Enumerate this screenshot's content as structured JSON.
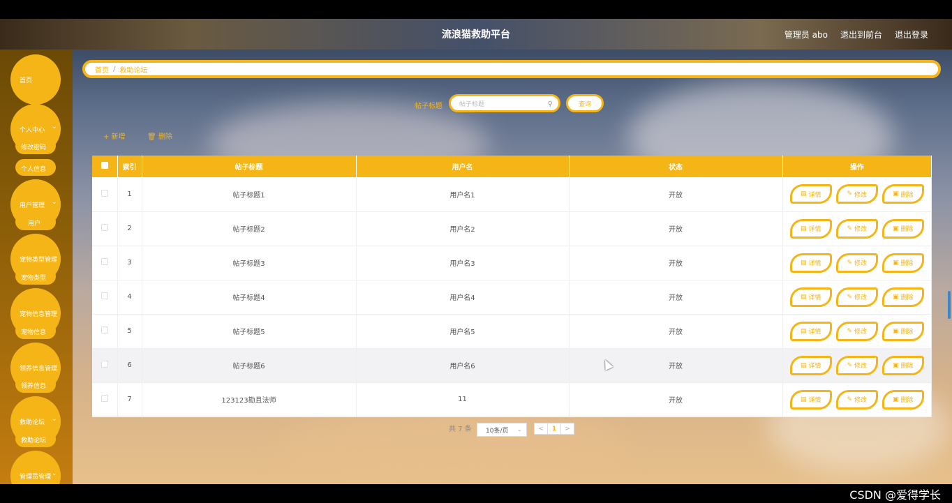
{
  "header": {
    "title": "流浪猫救助平台",
    "admin_label": "管理员 abo",
    "back_front": "退出到前台",
    "logout": "退出登录"
  },
  "sidebar": {
    "home": "首页",
    "personal_center": "个人中心",
    "change_password": "修改密码",
    "personal_info": "个人信息",
    "user_mgmt": "用户管理",
    "user": "用户",
    "pet_type_mgmt": "宠物类型管理",
    "pet_type": "宠物类型",
    "pet_info_mgmt": "宠物信息管理",
    "pet_info": "宠物信息",
    "adopt_info_mgmt": "领养信息管理",
    "adopt_info": "领养信息",
    "rescue_forum_group": "救助论坛",
    "rescue_forum": "救助论坛",
    "admin_mgmt": "管理员管理",
    "caret": "⌄"
  },
  "breadcrumb": {
    "home": "首页",
    "sep": "/",
    "current": "救助论坛"
  },
  "search": {
    "label": "帖子标题",
    "placeholder": "帖子标题",
    "button": "查询"
  },
  "toolbar": {
    "add": "+ 新增",
    "delete": "删除"
  },
  "table": {
    "columns": [
      "索引",
      "帖子标题",
      "用户名",
      "状态",
      "操作"
    ],
    "rows": [
      {
        "index": "1",
        "title": "帖子标题1",
        "username": "用户名1",
        "status": "开放"
      },
      {
        "index": "2",
        "title": "帖子标题2",
        "username": "用户名2",
        "status": "开放"
      },
      {
        "index": "3",
        "title": "帖子标题3",
        "username": "用户名3",
        "status": "开放"
      },
      {
        "index": "4",
        "title": "帖子标题4",
        "username": "用户名4",
        "status": "开放"
      },
      {
        "index": "5",
        "title": "帖子标题5",
        "username": "用户名5",
        "status": "开放"
      },
      {
        "index": "6",
        "title": "帖子标题6",
        "username": "用户名6",
        "status": "开放"
      },
      {
        "index": "7",
        "title": "123123勘且法师",
        "username": "11",
        "status": "开放"
      }
    ],
    "actions": {
      "detail": "详情",
      "edit": "修改",
      "delete": "删除"
    }
  },
  "pagination": {
    "total": "共 7 条",
    "page_size": "10条/页",
    "prev": "<",
    "current": "1",
    "next": ">"
  },
  "watermark": "CSDN @爱得学长",
  "colors": {
    "accent": "#f6b516"
  }
}
